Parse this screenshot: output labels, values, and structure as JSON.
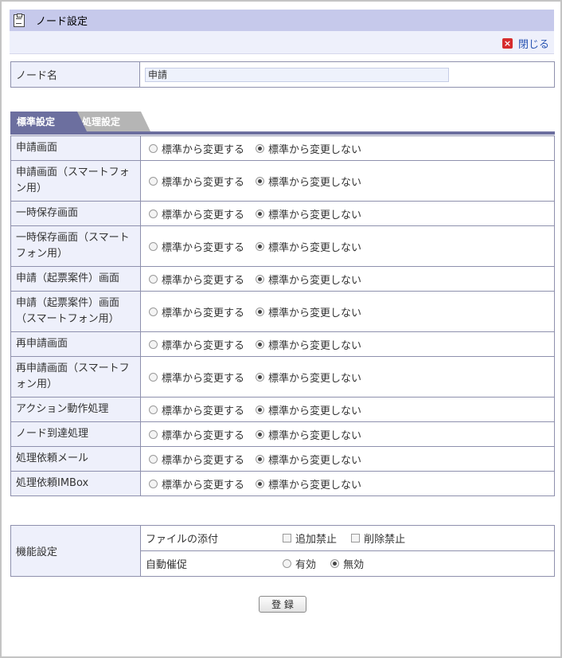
{
  "window": {
    "title": "ノード設定",
    "close_label": "閉じる"
  },
  "node_name": {
    "label": "ノード名",
    "value": "申請"
  },
  "tabs": [
    {
      "label": "標準設定",
      "active": true
    },
    {
      "label": "処理設定",
      "active": false
    }
  ],
  "option_labels": {
    "change": "標準から変更する",
    "no_change": "標準から変更しない"
  },
  "settings": [
    {
      "label": "申請画面",
      "selected": "no_change",
      "tall": false
    },
    {
      "label": "申請画面（スマートフォン用）",
      "selected": "no_change",
      "tall": true
    },
    {
      "label": "一時保存画面",
      "selected": "no_change",
      "tall": false
    },
    {
      "label": "一時保存画面（スマートフォン用）",
      "selected": "no_change",
      "tall": true
    },
    {
      "label": "申請（起票案件）画面",
      "selected": "no_change",
      "tall": false
    },
    {
      "label": "申請（起票案件）画面（スマートフォン用）",
      "selected": "no_change",
      "tall": true
    },
    {
      "label": "再申請画面",
      "selected": "no_change",
      "tall": false
    },
    {
      "label": "再申請画面（スマートフォン用）",
      "selected": "no_change",
      "tall": true
    },
    {
      "label": "アクション動作処理",
      "selected": "no_change",
      "tall": false
    },
    {
      "label": "ノード到達処理",
      "selected": "no_change",
      "tall": false
    },
    {
      "label": "処理依頼メール",
      "selected": "no_change",
      "tall": false
    },
    {
      "label": "処理依頼IMBox",
      "selected": "no_change",
      "tall": false
    }
  ],
  "function_settings": {
    "label": "機能設定",
    "attachment": {
      "label": "ファイルの添付",
      "add_ban": "追加禁止",
      "delete_ban": "削除禁止",
      "add_ban_checked": false,
      "delete_ban_checked": false
    },
    "auto_remind": {
      "label": "自動催促",
      "on": "有効",
      "off": "無効",
      "selected": "off"
    }
  },
  "submit_label": "登 録",
  "colors": {
    "title_bg": "#c6c9eb",
    "tab_active": "#6c6f9f",
    "tab_inactive": "#b5b5b5",
    "label_bg": "#eef0fb",
    "border": "#8e90ad",
    "close_icon": "#d62c2c"
  },
  "icons": {
    "title": "clipboard-icon",
    "close": "close-x-icon"
  }
}
